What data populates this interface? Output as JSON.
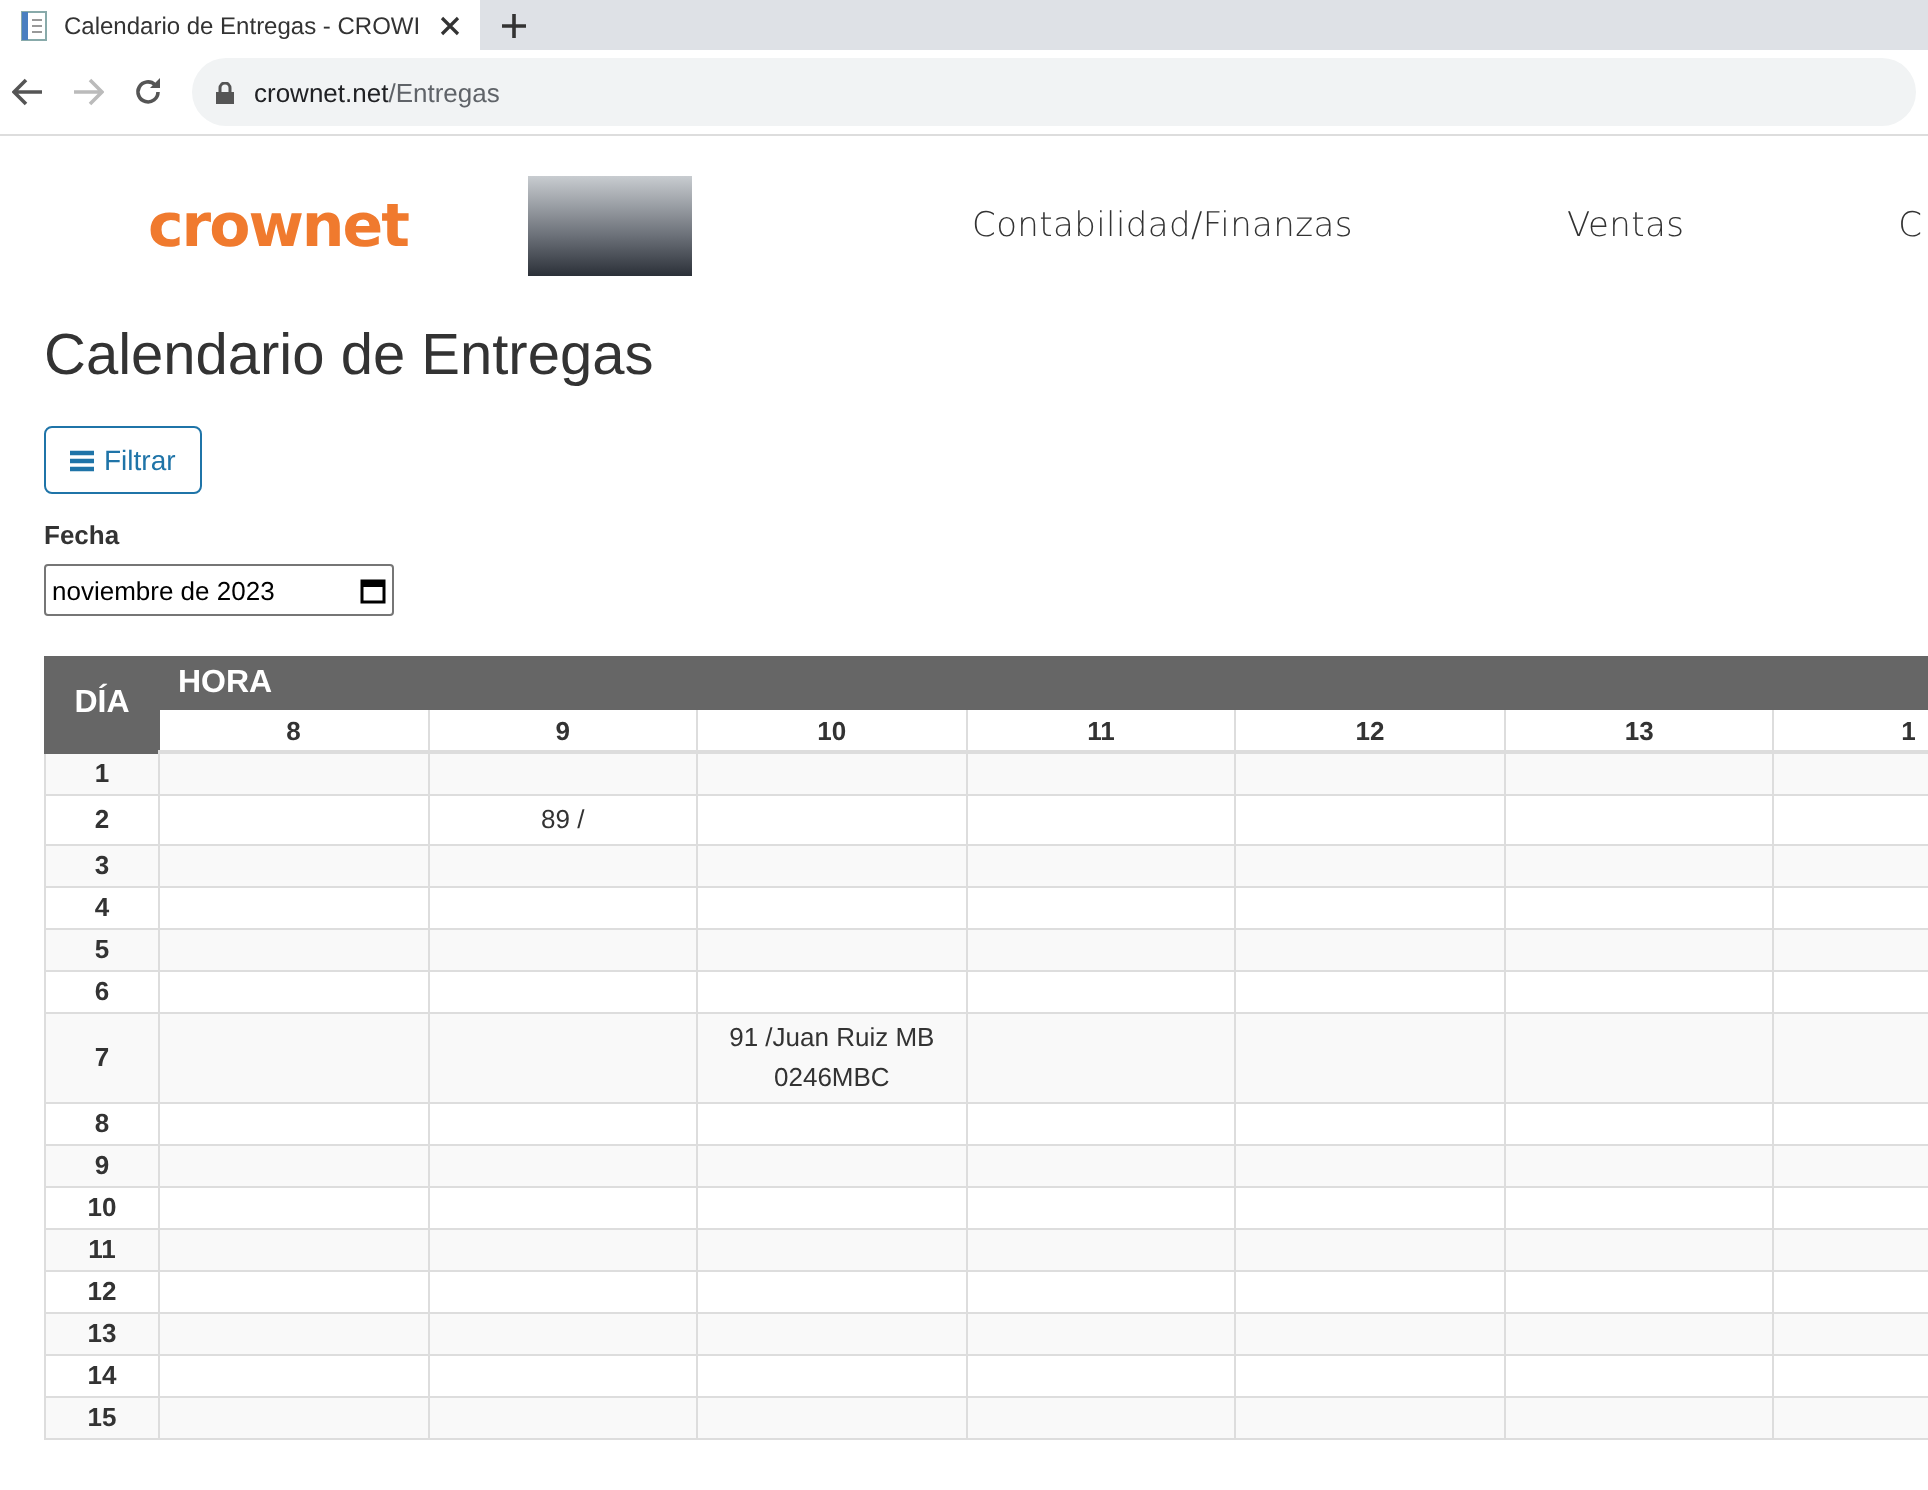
{
  "browser": {
    "tab_title": "Calendario de Entregas - CROWI",
    "url_host": "crownet.net",
    "url_path": "/Entregas"
  },
  "header": {
    "logo": "crownet",
    "nav": [
      {
        "label": "Contabilidad/Finanzas"
      },
      {
        "label": "Ventas"
      },
      {
        "label": "C"
      }
    ]
  },
  "page": {
    "title": "Calendario de Entregas",
    "filter_button": "Filtrar",
    "date_label": "Fecha",
    "date_value": "noviembre de 2023"
  },
  "table": {
    "day_header": "DÍA",
    "hour_header": "HORA",
    "hours": [
      "8",
      "9",
      "10",
      "11",
      "12",
      "13",
      "1"
    ],
    "rows": [
      {
        "day": "1",
        "cells": [
          {},
          {},
          {},
          {},
          {},
          {},
          {}
        ]
      },
      {
        "day": "2",
        "cells": [
          {},
          {
            "text": "89 /"
          },
          {},
          {},
          {},
          {},
          {}
        ]
      },
      {
        "day": "3",
        "cells": [
          {},
          {},
          {},
          {},
          {},
          {},
          {}
        ]
      },
      {
        "day": "4",
        "cells": [
          {},
          {},
          {},
          {},
          {},
          {},
          {}
        ]
      },
      {
        "day": "5",
        "cells": [
          {},
          {},
          {},
          {},
          {},
          {},
          {}
        ]
      },
      {
        "day": "6",
        "cells": [
          {},
          {},
          {},
          {},
          {},
          {},
          {}
        ]
      },
      {
        "day": "7",
        "cells": [
          {},
          {},
          {
            "text": "91 /Juan Ruiz MB 0246MBC"
          },
          {},
          {},
          {},
          {}
        ]
      },
      {
        "day": "8",
        "cells": [
          {},
          {},
          {},
          {},
          {},
          {},
          {}
        ]
      },
      {
        "day": "9",
        "cells": [
          {},
          {},
          {},
          {},
          {},
          {},
          {}
        ]
      },
      {
        "day": "10",
        "cells": [
          {},
          {},
          {},
          {},
          {},
          {},
          {}
        ]
      },
      {
        "day": "11",
        "cells": [
          {},
          {},
          {},
          {},
          {},
          {},
          {}
        ]
      },
      {
        "day": "12",
        "cells": [
          {},
          {},
          {},
          {},
          {},
          {},
          {}
        ]
      },
      {
        "day": "13",
        "cells": [
          {},
          {},
          {},
          {},
          {},
          {},
          {}
        ]
      },
      {
        "day": "14",
        "cells": [
          {},
          {},
          {},
          {},
          {},
          {},
          {}
        ]
      },
      {
        "day": "15",
        "cells": [
          {},
          {},
          {},
          {},
          {},
          {},
          {}
        ]
      }
    ]
  }
}
